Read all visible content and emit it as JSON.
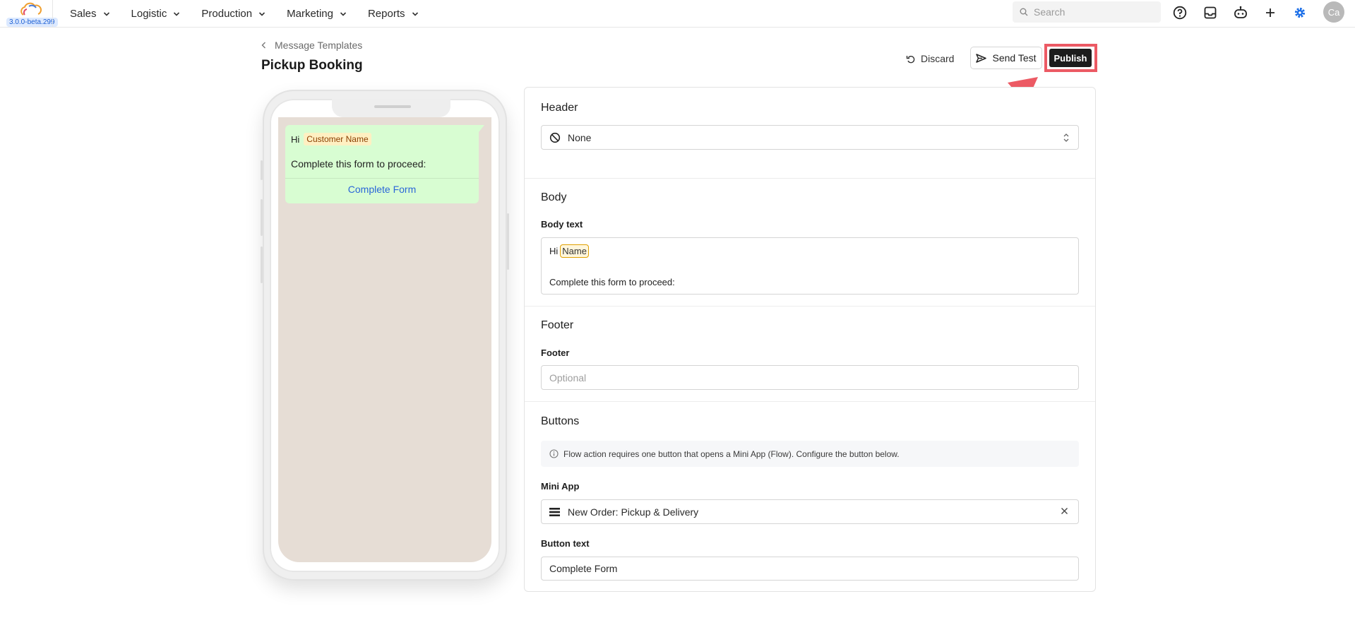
{
  "app": {
    "version": "3.0.0-beta.299",
    "nav": [
      {
        "label": "Sales"
      },
      {
        "label": "Logistic"
      },
      {
        "label": "Production"
      },
      {
        "label": "Marketing"
      },
      {
        "label": "Reports"
      }
    ],
    "search_placeholder": "Search",
    "avatar_initials": "Ca",
    "accent_color": "#1c6fe8"
  },
  "page": {
    "breadcrumb": "Message Templates",
    "title": "Pickup Booking",
    "actions": {
      "discard": "Discard",
      "send_test": "Send Test",
      "publish": "Publish"
    }
  },
  "preview": {
    "greeting": "Hi",
    "variable_chip": "Customer Name",
    "body_line": "Complete this form to proceed:",
    "cta_label": "Complete Form",
    "bubble_color": "#d8fdd2",
    "chat_bg_color": "#e6ddd5"
  },
  "form": {
    "header": {
      "title": "Header",
      "selected": "None"
    },
    "body": {
      "title": "Body",
      "label": "Body text",
      "greeting": "Hi",
      "variable": "Name",
      "line2": "Complete this form to proceed:"
    },
    "footer": {
      "title": "Footer",
      "label": "Footer",
      "placeholder": "Optional",
      "value": ""
    },
    "buttons": {
      "title": "Buttons",
      "info": "Flow action requires one button that opens a Mini App (Flow). Configure the button below.",
      "mini_app_label": "Mini App",
      "mini_app_value": "New Order: Pickup & Delivery",
      "button_text_label": "Button text",
      "button_text_value": "Complete Form"
    }
  },
  "annotation": {
    "highlight_color": "#ec5a64"
  }
}
